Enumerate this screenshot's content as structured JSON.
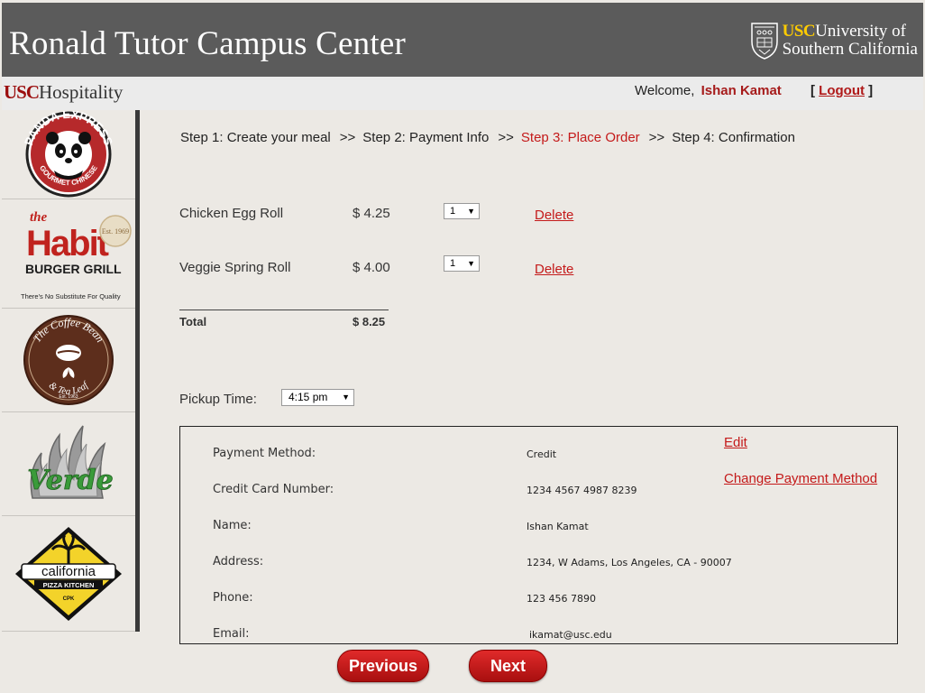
{
  "header": {
    "title": "Ronald Tutor Campus Center",
    "usc_logo_gold": "USC",
    "usc_logo_line1": "University of",
    "usc_logo_line2": "Southern California"
  },
  "subheader": {
    "hospitality_red": "USC",
    "hospitality_text": "Hospitality",
    "welcome_text": "Welcome,",
    "user_name": "Ishan Kamat",
    "logout_open": "[",
    "logout_label": "Logout",
    "logout_close": "]"
  },
  "sidebar": {
    "items": [
      {
        "name": "Panda Express",
        "text_top": "PANDA EXPRESS",
        "text_bottom": "GOURMET CHINESE"
      },
      {
        "name": "The Habit Burger Grill",
        "text_the": "the",
        "text_main": "Habit",
        "text_sub": "BURGER GRILL",
        "text_tag": "There's No Substitute For Quality",
        "badge": "Est. 1969"
      },
      {
        "name": "The Coffee Bean & Tea Leaf",
        "text_top": "The Coffee Bean",
        "text_bottom": "& Tea Leaf",
        "est": "Est. 1963"
      },
      {
        "name": "Verde",
        "text": "Verde"
      },
      {
        "name": "California Pizza Kitchen",
        "text_main": "california",
        "text_sub": "PIZZA KITCHEN",
        "text_cpk": "CPK"
      }
    ]
  },
  "steps": {
    "step1": "Step 1: Create your meal",
    "step2": "Step 2: Payment Info",
    "step3": "Step 3: Place Order",
    "step4": "Step 4: Confirmation",
    "separator": ">>"
  },
  "order": {
    "items": [
      {
        "name": "Chicken Egg Roll",
        "price": "$ 4.25",
        "qty": "1",
        "delete": "Delete"
      },
      {
        "name": "Veggie Spring Roll",
        "price": "$ 4.00",
        "qty": "1",
        "delete": "Delete"
      }
    ],
    "total_label": "Total",
    "total_value": "$ 8.25"
  },
  "pickup": {
    "label": "Pickup Time:",
    "value": "4:15 pm"
  },
  "payment": {
    "method_label": "Payment Method:",
    "method_value": "Credit",
    "card_label": "Credit Card Number:",
    "card_value": "1234 4567 4987 8239",
    "name_label": "Name:",
    "name_value": "Ishan Kamat",
    "address_label": "Address:",
    "address_value": "1234, W Adams, Los Angeles, CA - 90007",
    "phone_label": "Phone:",
    "phone_value": "123 456 7890",
    "email_label": "Email:",
    "email_value": "ikamat@usc.edu",
    "edit_link": "Edit",
    "change_link": "Change Payment Method"
  },
  "buttons": {
    "previous": "Previous",
    "next": "Next"
  },
  "colors": {
    "accent_red": "#c41a1a",
    "header_gray": "#5b5b5b",
    "usc_gold": "#ffcc00"
  }
}
